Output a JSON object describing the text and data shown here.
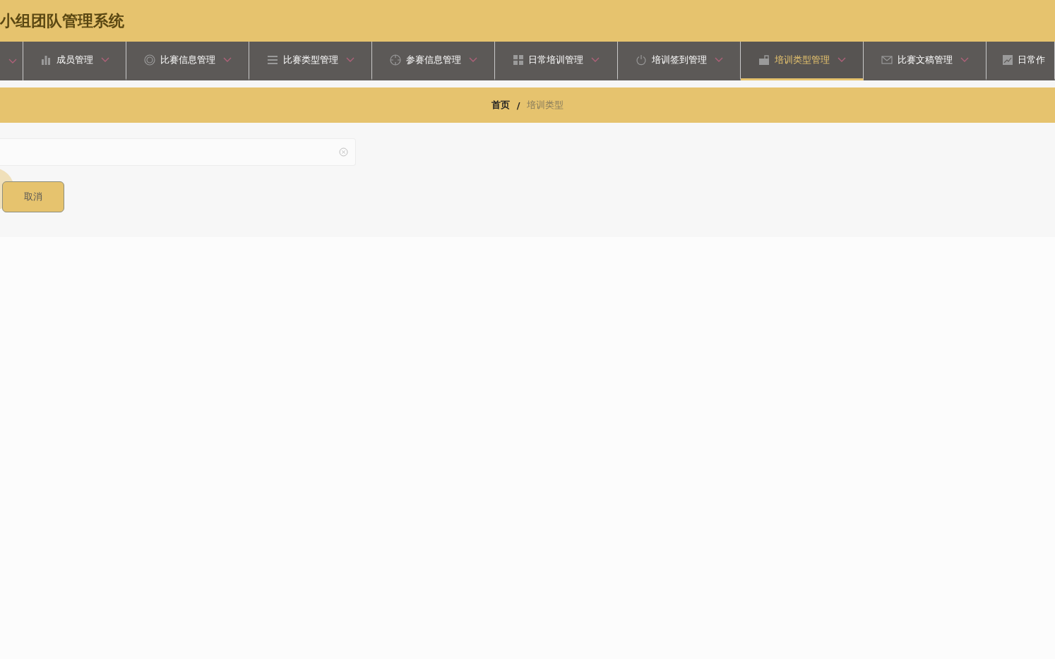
{
  "header": {
    "title": "小组团队管理系统"
  },
  "nav": [
    {
      "label": "成员管理",
      "selected": false
    },
    {
      "label": "比赛信息管理",
      "selected": false
    },
    {
      "label": "比赛类型管理",
      "selected": false
    },
    {
      "label": "参赛信息管理",
      "selected": false
    },
    {
      "label": "日常培训管理",
      "selected": false
    },
    {
      "label": "培训签到管理",
      "selected": false
    },
    {
      "label": "培训类型管理",
      "selected": true
    },
    {
      "label": "比赛文稿管理",
      "selected": false
    },
    {
      "label": "日常作",
      "selected": false
    }
  ],
  "breadcrumb": [
    "首页",
    "培训类型"
  ],
  "breadcrumb_separator": "/",
  "form": {
    "buttons": [
      "取消"
    ]
  }
}
